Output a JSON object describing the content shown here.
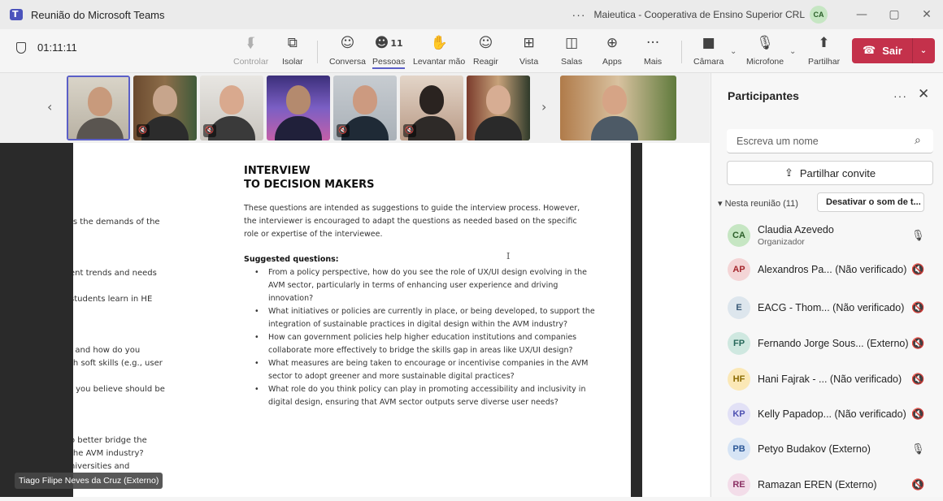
{
  "window": {
    "title": "Reunião do Microsoft Teams",
    "more": "···",
    "organization": "Maieutica - Cooperativa de Ensino Superior CRL",
    "org_initials": "CA",
    "minimize": "—",
    "maximize": "▢",
    "close": "✕"
  },
  "toolbar": {
    "timer": "01:11:11",
    "participants_count": "11",
    "buttons": {
      "control": "Controlar",
      "isolate": "Isolar",
      "chat": "Conversa",
      "people": "Pessoas",
      "raise_hand": "Levantar mão",
      "react": "Reagir",
      "view": "Vista",
      "rooms": "Salas",
      "apps": "Apps",
      "more": "Mais",
      "camera": "Câmara",
      "mic": "Microfone",
      "share": "Partilhar",
      "leave": "Sair"
    },
    "icons": {
      "control": "⮮",
      "isolate": "⧉",
      "chat": "☺",
      "people": "☻",
      "raise_hand": "✋",
      "react": "☺",
      "view": "⊞",
      "rooms": "◫",
      "apps": "⊕",
      "more": "···",
      "camera": "■",
      "mic": "🎙",
      "share": "⬆",
      "leave": "☎",
      "chevron": "⌄"
    }
  },
  "stage": {
    "prev_arrow": "‹",
    "next_arrow": "›",
    "mute_glyph": "🔇",
    "document": {
      "cut_lines": [
        "ts the demands of the",
        "ent trends and needs",
        "students learn in HE",
        ", and how do you",
        "th soft skills (e.g., user",
        "t you believe should be",
        "o better bridge the",
        " the AVM industry?",
        "niversities and"
      ],
      "title_line1": "INTERVIEW",
      "title_line2": "TO DECISION MAKERS",
      "intro": "These questions are intended as suggestions to guide the interview process. However, the interviewer is encouraged to adapt the questions as needed based on the specific role or expertise of the interviewee.",
      "suggested_heading": "Suggested questions:",
      "questions": [
        "From a policy perspective, how do you see the role of UX/UI design evolving in the AVM sector, particularly in terms of enhancing user experience and driving innovation?",
        "What initiatives or policies are currently in place, or being developed, to support the integration of sustainable practices in digital design within the AVM industry?",
        "How can government policies help higher education institutions and companies collaborate more effectively to bridge the skills gap in areas like UX/UI design?",
        "What measures are being taken to encourage or incentivise companies in the AVM sector to adopt greener and more sustainable digital practices?",
        "What role do you think policy can play in promoting accessibility and inclusivity in digital design, ensuring that AVM sector outputs serve diverse user needs?"
      ],
      "cursor": "I"
    },
    "presenter_name": "Tiago Filipe Neves da Cruz (Externo)"
  },
  "panel": {
    "title": "Participantes",
    "more": "···",
    "close": "✕",
    "search_placeholder": "Escreva um nome",
    "search_icon": "⌕",
    "share_invite": "Partilhar convite",
    "share_icon": "⇪",
    "in_meeting": "▾ Nesta reunião (11)",
    "mute_all": "Desativar o som de t...",
    "participants": [
      {
        "initials": "CA",
        "name": "Claudia Azevedo",
        "role": "Organizador",
        "mic": "🎙",
        "avatar_bg": "#c6e6c3",
        "avatar_fg": "#2c5f2a"
      },
      {
        "initials": "AP",
        "name": "Alexandros Pa... (Não verificado)",
        "role": "",
        "mic": "🔇",
        "avatar_bg": "#f4d5d6",
        "avatar_fg": "#a4262c"
      },
      {
        "initials": "E",
        "name": "EACG - Thom... (Não verificado)",
        "role": "",
        "mic": "🔇",
        "avatar_bg": "#dde6ed",
        "avatar_fg": "#3a5a78"
      },
      {
        "initials": "FP",
        "name": "Fernando Jorge Sous... (Externo)",
        "role": "",
        "mic": "🔇",
        "avatar_bg": "#cfe8e0",
        "avatar_fg": "#27685a"
      },
      {
        "initials": "HF",
        "name": "Hani Fajrak - ... (Não verificado)",
        "role": "",
        "mic": "🔇",
        "avatar_bg": "#fbe8b6",
        "avatar_fg": "#8a6a00"
      },
      {
        "initials": "KP",
        "name": "Kelly Papadop... (Não verificado)",
        "role": "",
        "mic": "🔇",
        "avatar_bg": "#e2e1f6",
        "avatar_fg": "#4f52b2"
      },
      {
        "initials": "PB",
        "name": "Petyo Budakov (Externo)",
        "role": "",
        "mic": "🎙",
        "avatar_bg": "#d6e4f5",
        "avatar_fg": "#2b5797"
      },
      {
        "initials": "RE",
        "name": "Ramazan EREN (Externo)",
        "role": "",
        "mic": "🔇",
        "avatar_bg": "#f3dde9",
        "avatar_fg": "#8b2f63"
      }
    ]
  },
  "colors": {
    "accent": "#5b5fc7",
    "leave": "#c4314b"
  }
}
